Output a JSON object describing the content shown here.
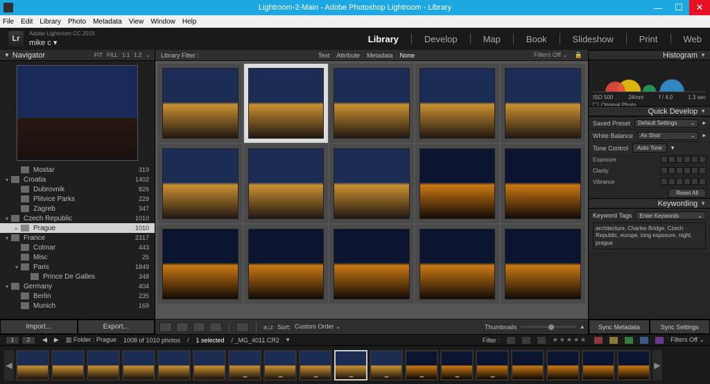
{
  "titlebar": {
    "title": "Lightroom-2-Main - Adobe Photoshop Lightroom - Library"
  },
  "menubar": [
    "File",
    "Edit",
    "Library",
    "Photo",
    "Metadata",
    "View",
    "Window",
    "Help"
  ],
  "identity": {
    "product": "Adobe Lightroom CC 2015",
    "user": "mike c ▾"
  },
  "modules": [
    "Library",
    "Develop",
    "Map",
    "Book",
    "Slideshow",
    "Print",
    "Web"
  ],
  "active_module": "Library",
  "navigator": {
    "title": "Navigator",
    "modes": [
      "FIT",
      "FILL",
      "1:1",
      "1:2"
    ]
  },
  "folders": [
    {
      "indent": 1,
      "tw": "",
      "name": "Mostar",
      "count": "319"
    },
    {
      "indent": 0,
      "tw": "▾",
      "name": "Croatia",
      "count": "1402"
    },
    {
      "indent": 1,
      "tw": "",
      "name": "Dubrovnik",
      "count": "826"
    },
    {
      "indent": 1,
      "tw": "",
      "name": "Plitvice Parks",
      "count": "229"
    },
    {
      "indent": 1,
      "tw": "",
      "name": "Zagreb",
      "count": "347"
    },
    {
      "indent": 0,
      "tw": "▾",
      "name": "Czech Republic",
      "count": "1010"
    },
    {
      "indent": 1,
      "tw": "▸",
      "name": "Prague",
      "count": "1010",
      "selected": true
    },
    {
      "indent": 0,
      "tw": "▾",
      "name": "France",
      "count": "2317"
    },
    {
      "indent": 1,
      "tw": "",
      "name": "Colmar",
      "count": "443"
    },
    {
      "indent": 1,
      "tw": "",
      "name": "Misc",
      "count": "25"
    },
    {
      "indent": 1,
      "tw": "▾",
      "name": "Paris",
      "count": "1849"
    },
    {
      "indent": 2,
      "tw": "",
      "name": "Prince De Galles",
      "count": "348"
    },
    {
      "indent": 0,
      "tw": "▾",
      "name": "Germany",
      "count": "404"
    },
    {
      "indent": 1,
      "tw": "",
      "name": "Berlin",
      "count": "235"
    },
    {
      "indent": 1,
      "tw": "",
      "name": "Munich",
      "count": "169"
    }
  ],
  "leftbtns": {
    "import": "Import...",
    "export": "Export..."
  },
  "filterbar": {
    "title": "Library Filter :",
    "tabs": [
      "Text",
      "Attribute",
      "Metadata",
      "None"
    ],
    "active": "None",
    "filters_off": "Filters Off"
  },
  "toolbar": {
    "sort_label": "Sort:",
    "sort_value": "Custom Order",
    "thumb_label": "Thumbnails"
  },
  "histogram": {
    "title": "Histogram",
    "iso": "ISO 500",
    "focal": "24mm",
    "aperture": "f / 4.0",
    "shutter": "1.3 sec",
    "orig": "Original Photo"
  },
  "quickdev": {
    "title": "Quick Develop",
    "preset_lbl": "Saved Preset",
    "preset_val": "Default Settings",
    "wb_lbl": "White Balance",
    "wb_val": "As Shot",
    "tone_lbl": "Tone Control",
    "tone_btn": "Auto Tone",
    "exposure": "Exposure",
    "clarity": "Clarity",
    "vibrance": "Vibrance",
    "reset": "Reset All"
  },
  "keywording": {
    "title": "Keywording",
    "tags_lbl": "Keyword Tags",
    "tags_val": "Enter Keywords",
    "tags_text": "architecture, Charles Bridge, Czech Republic, europe, long exposure, night, prague"
  },
  "rightbtns": {
    "meta": "Sync Metadata",
    "settings": "Sync Settings"
  },
  "filminfo": {
    "screen": "2",
    "folder_lbl": "Folder : Prague",
    "status": "1008 of 1010 photos",
    "selected": "1 selected",
    "file": "/ _MG_4011.CR2",
    "filter_lbl": "Filter :",
    "filters_off": "Filters Off"
  }
}
